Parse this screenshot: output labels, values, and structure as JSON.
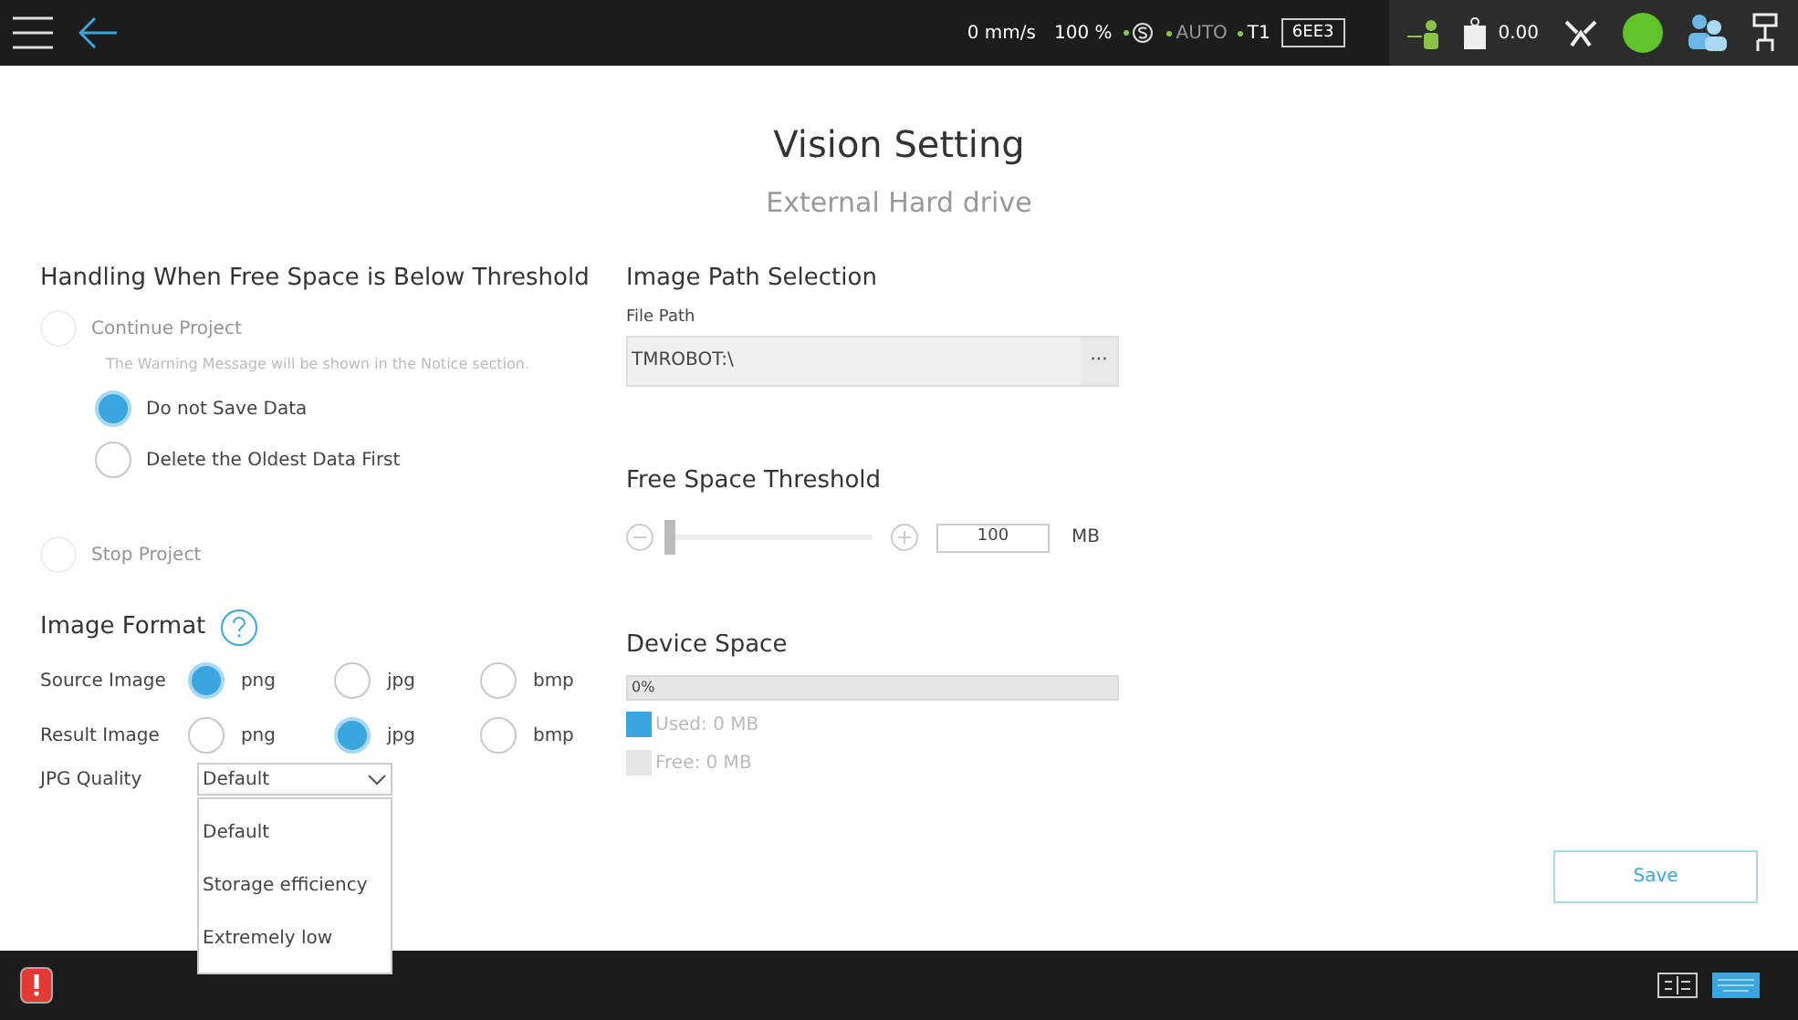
{
  "top_bar": {
    "speed": "0 mm/s",
    "percent": "100 %",
    "indicators": [
      {
        "label": "AUTO",
        "color": "#8bc34a"
      },
      {
        "label": "T1",
        "color": "#8bc34a"
      }
    ],
    "code": "6EE3",
    "payload": "0.00"
  },
  "header": {
    "title": "Vision Setting",
    "subtitle": "External Hard drive"
  },
  "handling": {
    "title": "Handling When Free Space is Below Threshold",
    "options": [
      {
        "label": "Continue Project",
        "selected": false,
        "disabled": true,
        "note": "The Warning Message will be shown in the Notice section.",
        "children": [
          {
            "label": "Do not Save Data",
            "selected": true,
            "disabled": false
          },
          {
            "label": "Delete the Oldest Data First",
            "selected": false,
            "disabled": false
          }
        ]
      },
      {
        "label": "Stop Project",
        "selected": false,
        "disabled": true
      }
    ]
  },
  "image_format": {
    "title": "Image Format",
    "rows": [
      {
        "label": "Source Image",
        "options": [
          {
            "label": "png",
            "selected": true
          },
          {
            "label": "jpg",
            "selected": false
          },
          {
            "label": "bmp",
            "selected": false
          }
        ]
      },
      {
        "label": "Result Image",
        "options": [
          {
            "label": "png",
            "selected": false
          },
          {
            "label": "jpg",
            "selected": true
          },
          {
            "label": "bmp",
            "selected": false
          }
        ]
      }
    ],
    "jpg_quality": {
      "label": "JPG Quality",
      "value": "Default",
      "expanded": true,
      "options": [
        "Default",
        "Storage efficiency",
        "Extremely low"
      ]
    }
  },
  "image_path": {
    "title": "Image Path Selection",
    "label": "File Path",
    "value": "TMROBOT:\\",
    "browse": "···"
  },
  "threshold": {
    "title": "Free Space Threshold",
    "level": 0,
    "value": "100",
    "unit": "MB"
  },
  "device_space": {
    "title": "Device Space",
    "level": 0,
    "reading": "0%",
    "legend": [
      {
        "label": "Used: 0 MB",
        "color": "#3aa6e0"
      },
      {
        "label": "Free: 0 MB",
        "color": "#e6e6e6"
      }
    ]
  },
  "save_button": "Save"
}
